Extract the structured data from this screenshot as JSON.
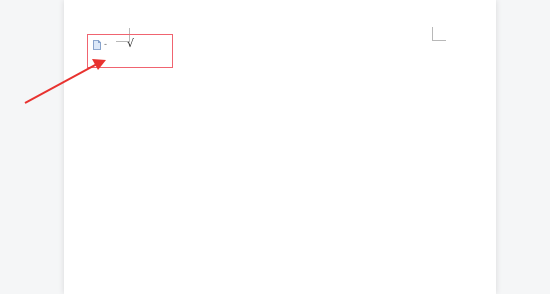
{
  "document": {
    "first_line": {
      "icon": "document-icon",
      "dash_text": "-",
      "mark_text": "√"
    }
  },
  "annotation": {
    "highlight_color": "#f06470",
    "arrow_color": "#e8322f"
  }
}
